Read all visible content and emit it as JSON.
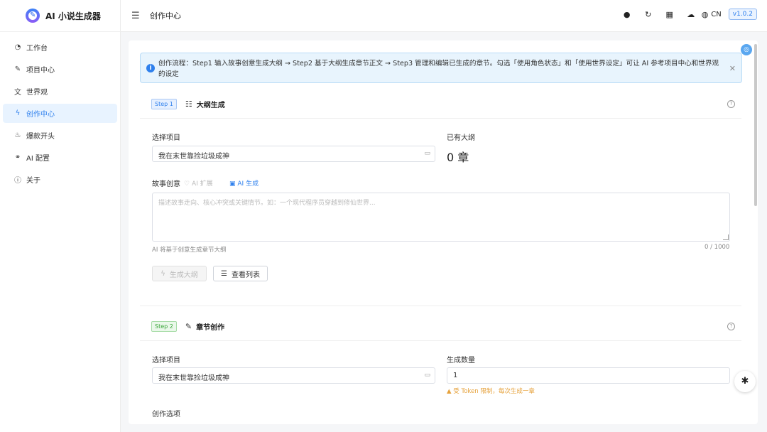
{
  "app": {
    "title": "AI 小说生成器",
    "logo_glyph": "✎"
  },
  "sidebar": {
    "items": [
      {
        "label": "工作台",
        "icon": "dashboard-icon",
        "glyph": "◔",
        "active": false
      },
      {
        "label": "项目中心",
        "icon": "edit-square-icon",
        "glyph": "✎",
        "active": false
      },
      {
        "label": "世界观",
        "icon": "translate-icon",
        "glyph": "文",
        "active": false
      },
      {
        "label": "创作中心",
        "icon": "lightning-icon",
        "glyph": "ϟ",
        "active": true
      },
      {
        "label": "爆款开头",
        "icon": "fire-icon",
        "glyph": "♨",
        "active": false
      },
      {
        "label": "AI 配置",
        "icon": "link-icon",
        "glyph": "⚭",
        "active": false
      },
      {
        "label": "关于",
        "icon": "info-icon",
        "glyph": "ⓘ",
        "active": false
      }
    ]
  },
  "header": {
    "title": "创作中心",
    "lang": "CN",
    "version": "v1.0.2"
  },
  "alert": {
    "text": "创作流程：Step1 输入故事创意生成大纲 → Step2 基于大纲生成章节正文 → Step3 管理和编辑已生成的章节。勾选「使用角色状态」和「使用世界设定」可让 AI 参考项目中心和世界观的设定"
  },
  "step1": {
    "badge": "Step 1",
    "title": "大纲生成",
    "project_label": "选择项目",
    "project_value": "我在末世靠捡垃圾成神",
    "outline_label": "已有大纲",
    "outline_value": "0 章",
    "idea_label": "故事创意",
    "ai_expand": "AI 扩展",
    "ai_generate": "AI 生成",
    "idea_placeholder": "描述故事走向、核心冲突或关键情节。如：一个现代程序员穿越到修仙世界...",
    "idea_hint": "AI 将基于创意生成章节大纲",
    "char_count": "0 / 1000",
    "generate_button": "生成大纲",
    "view_list_button": "查看列表"
  },
  "step2": {
    "badge": "Step 2",
    "title": "章节创作",
    "project_label": "选择项目",
    "project_value": "我在末世靠捡垃圾成神",
    "count_label": "生成数量",
    "count_value": "1",
    "token_warning": "受 Token 限制，每次生成一章",
    "options_label": "创作选项"
  },
  "colors": {
    "accent": "#2f80ed",
    "alert_bg": "#e8f4fd",
    "warning": "#e6a23c",
    "step2_green": "#3aa53a"
  }
}
